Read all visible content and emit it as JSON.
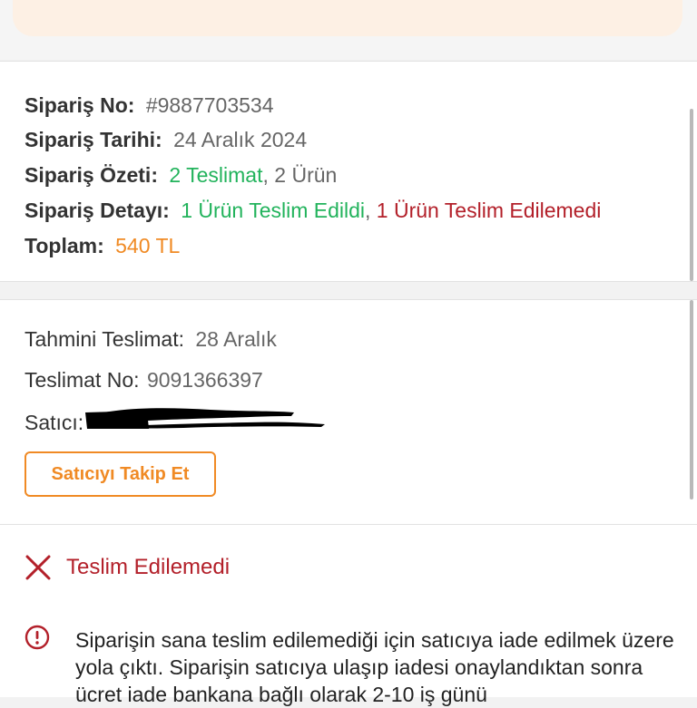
{
  "order": {
    "no_label": "Sipariş No:",
    "no_value": "#9887703534",
    "date_label": "Sipariş Tarihi:",
    "date_value": "24 Aralık 2024",
    "summary_label": "Sipariş Özeti:",
    "summary_deliveries": "2 Teslimat",
    "summary_products": ", 2 Ürün",
    "detail_label": "Sipariş Detayı:",
    "detail_delivered": "1 Ürün Teslim Edildi",
    "detail_sep": ",",
    "detail_undelivered": "1 Ürün Teslim Edilemedi",
    "total_label": "Toplam:",
    "total_value": "540 TL"
  },
  "delivery": {
    "estimated_label": "Tahmini Teslimat:",
    "estimated_value": "28 Aralık",
    "no_label": "Teslimat No:",
    "no_value": "9091366397",
    "seller_label": "Satıcı:",
    "follow_button": "Satıcıyı Takip Et"
  },
  "status": {
    "title": "Teslim Edilemedi",
    "info_text": "Siparişin sana teslim edilemediği için satıcıya iade edilmek üzere yola çıktı. Siparişin satıcıya ulaşıp iadesi onaylandıktan sonra ücret iade bankana bağlı olarak 2-10 iş günü"
  },
  "colors": {
    "green": "#22b35c",
    "red": "#b3202a",
    "orange": "#f08a24"
  },
  "icons": {
    "status": "close-icon",
    "info": "info-icon"
  }
}
